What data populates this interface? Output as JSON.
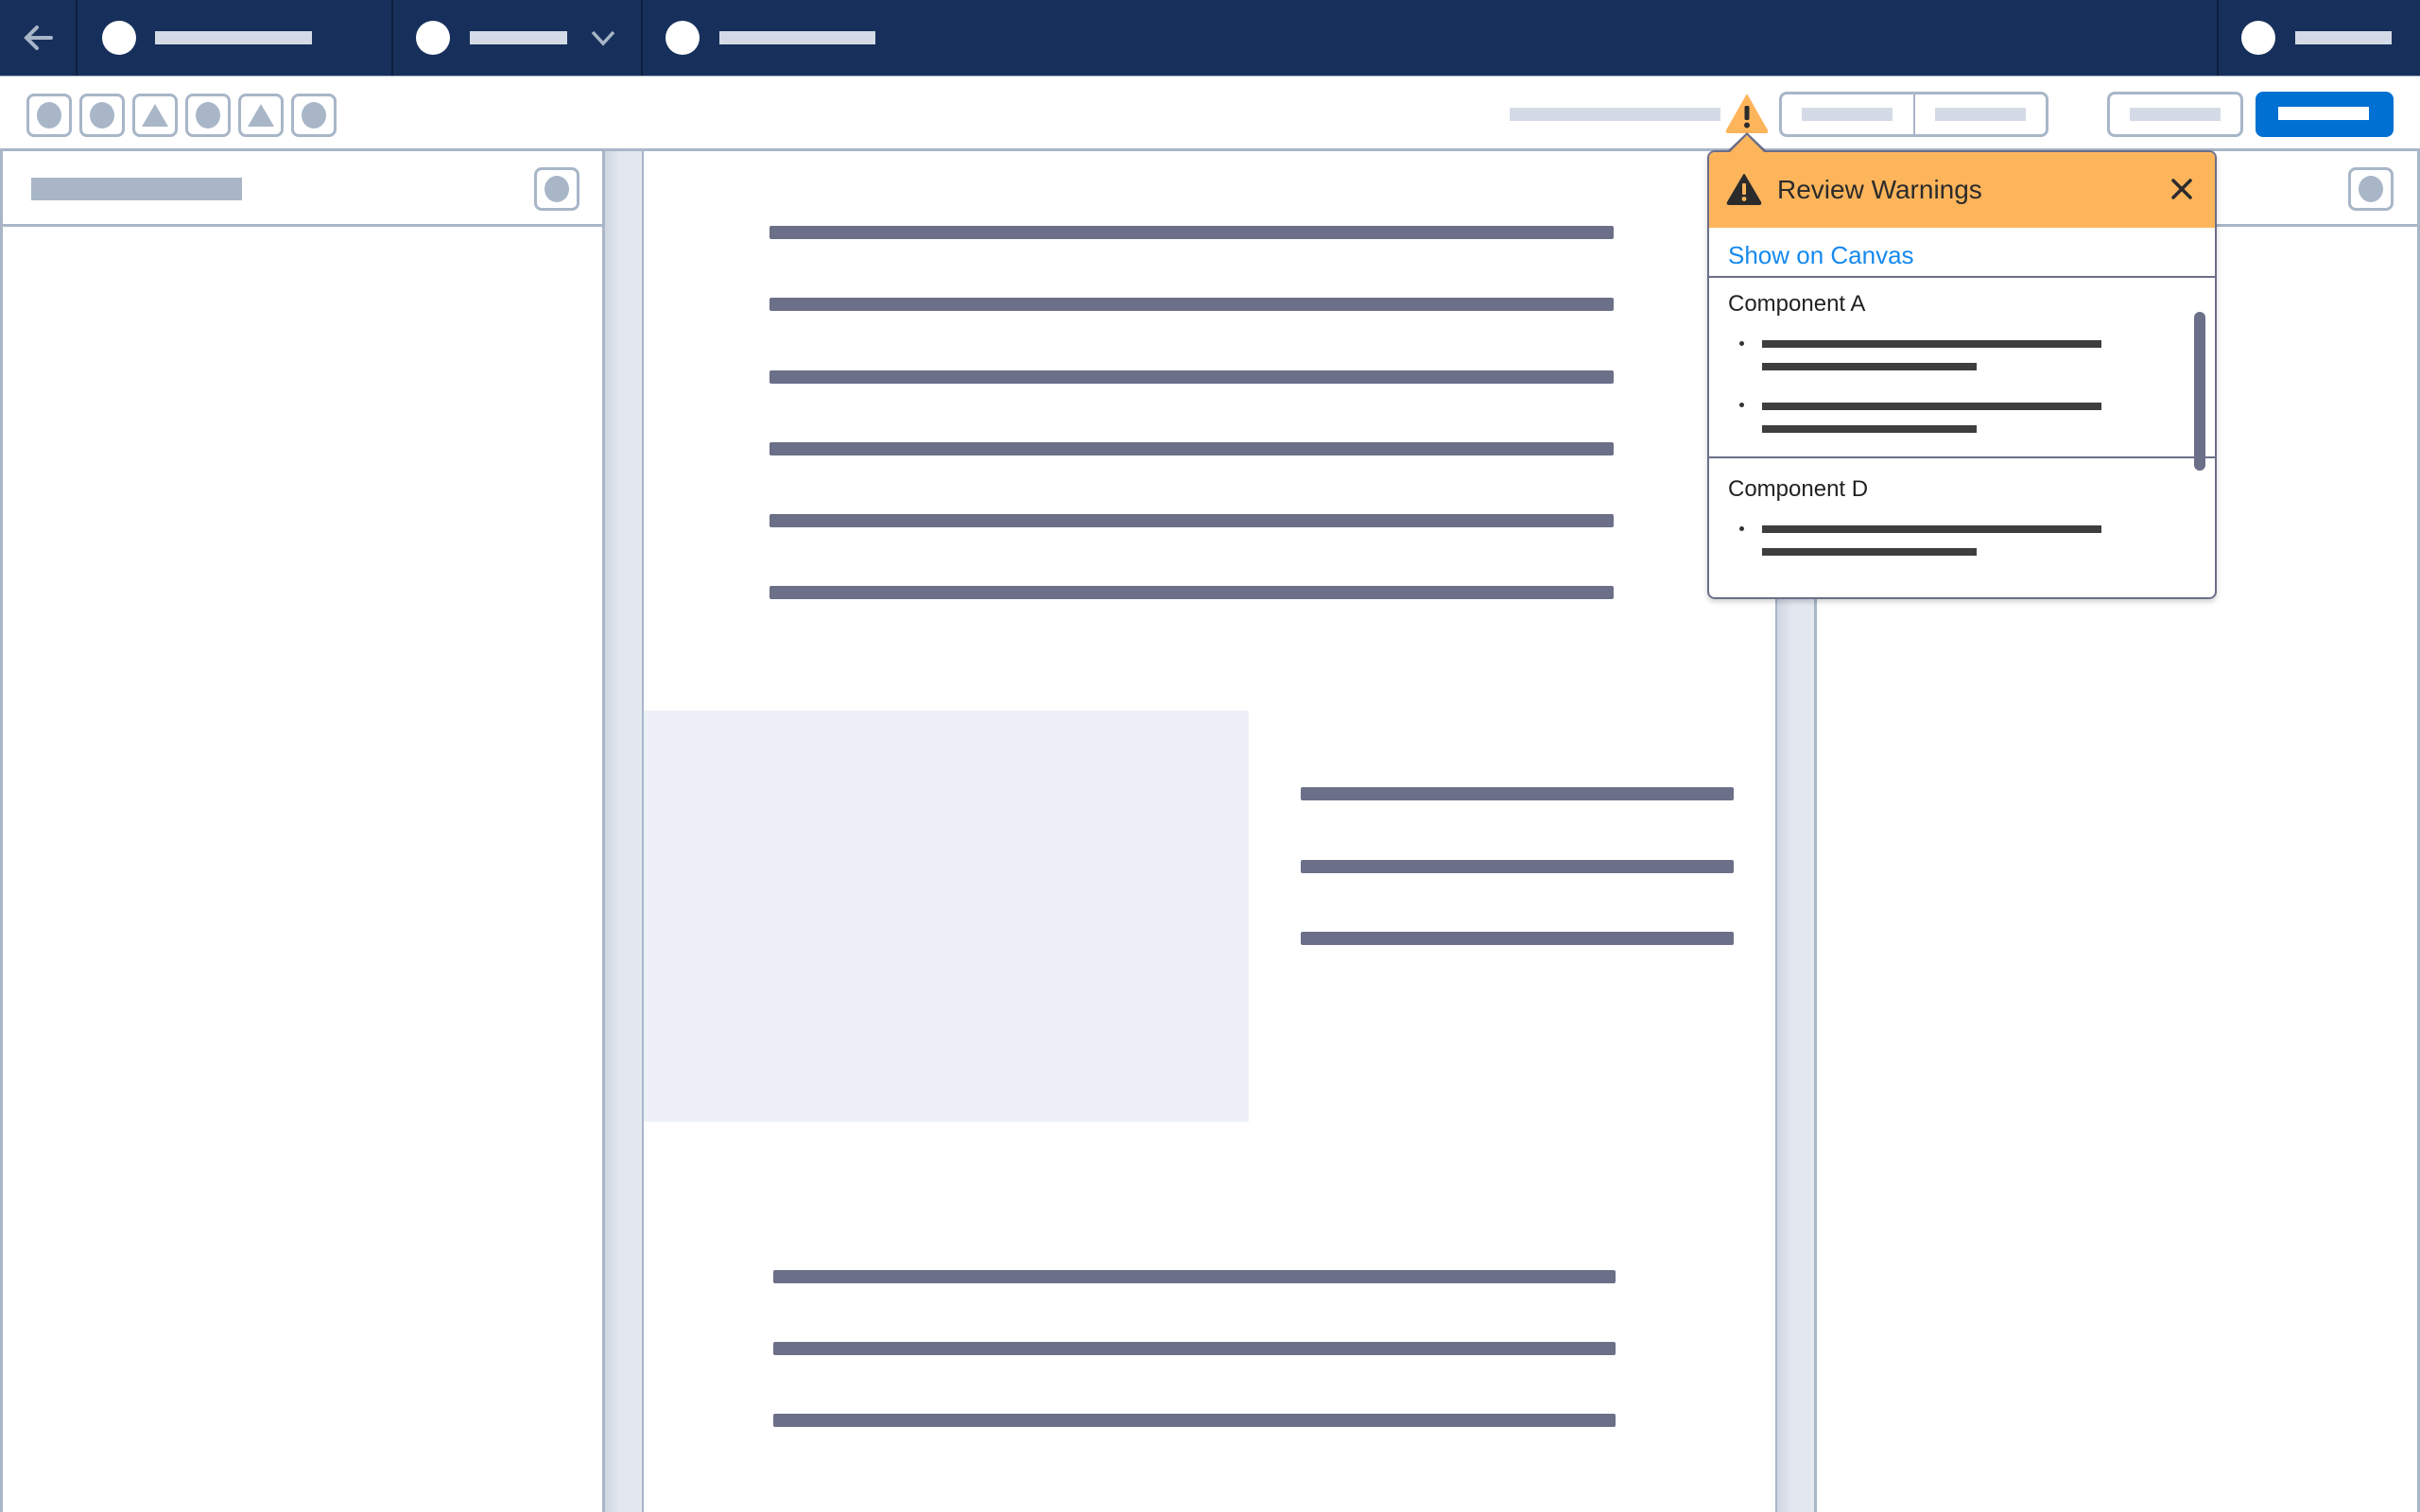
{
  "topnav": {
    "back_icon": "arrow-left-icon",
    "tabs": [
      {
        "icon": "circle-icon",
        "label_placeholder": "tab-1",
        "has_dropdown": false
      },
      {
        "icon": "circle-icon",
        "label_placeholder": "tab-2",
        "has_dropdown": true
      },
      {
        "icon": "circle-icon",
        "label_placeholder": "tab-3",
        "has_dropdown": false
      }
    ],
    "user_menu": {
      "icon": "circle-icon"
    }
  },
  "toolbar": {
    "tools": [
      {
        "icon": "circle-icon"
      },
      {
        "icon": "circle-icon"
      },
      {
        "icon": "triangle-icon"
      },
      {
        "icon": "circle-icon"
      },
      {
        "icon": "triangle-icon"
      },
      {
        "icon": "circle-icon"
      }
    ],
    "warning_icon": "warning-icon",
    "primary_color": "#0070d2"
  },
  "popover": {
    "title": "Review Warnings",
    "header_color": "#fdb55c",
    "close_icon": "close-icon",
    "link": "Show on Canvas",
    "link_color": "#1589ee",
    "components": [
      {
        "name": "Component A",
        "warning_count": 2
      },
      {
        "name": "Component D",
        "warning_count": 1
      }
    ]
  },
  "colors": {
    "nav_bg": "#17305b",
    "border": "#a8b6c8",
    "text_placeholder": "#6b6f88",
    "image_placeholder": "#edf0f7"
  }
}
